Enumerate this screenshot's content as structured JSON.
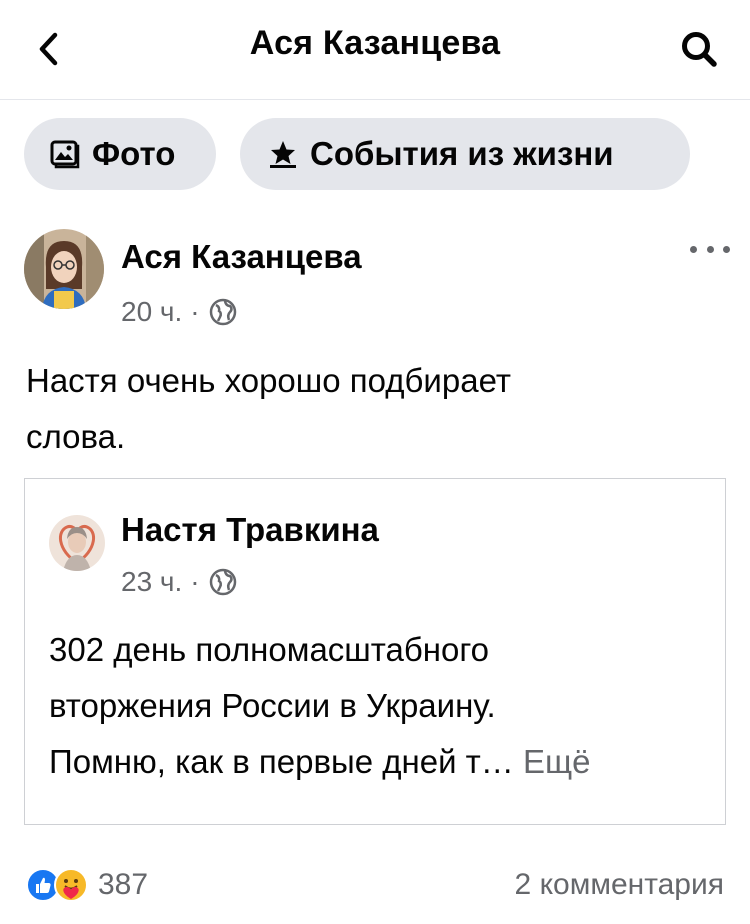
{
  "header": {
    "title": "Ася Казанцева",
    "back_icon": "chevron-left-icon",
    "search_icon": "search-icon"
  },
  "chips": {
    "photo_label": "Фото",
    "photo_icon": "photo-album-icon",
    "events_label": "События из жизни",
    "events_icon": "star-icon"
  },
  "post": {
    "author": "Ася Казанцева",
    "time": "20 ч.",
    "separator": "·",
    "privacy_icon": "globe-icon",
    "more_icon": "more-horizontal-icon",
    "text_line1": "Настя очень хорошо подбирает",
    "text_line2": "слова."
  },
  "shared_post": {
    "author": "Настя Травкина",
    "time": "23 ч.",
    "separator": "·",
    "privacy_icon": "globe-icon",
    "text_line1": "302 день полномасштабного",
    "text_line2": "вторжения России в Украину.",
    "text_line3": "Помню, как в первые дней т…",
    "see_more": "Ещё"
  },
  "footer": {
    "reactions_count": "387",
    "comments": "2 комментария",
    "reaction_icons": [
      "like-icon",
      "care-icon"
    ]
  },
  "colors": {
    "text": "#050505",
    "secondary_text": "#65676b",
    "chip_bg": "#e4e6eb",
    "like_blue": "#1877f2",
    "care_yellow": "#f7b928"
  }
}
